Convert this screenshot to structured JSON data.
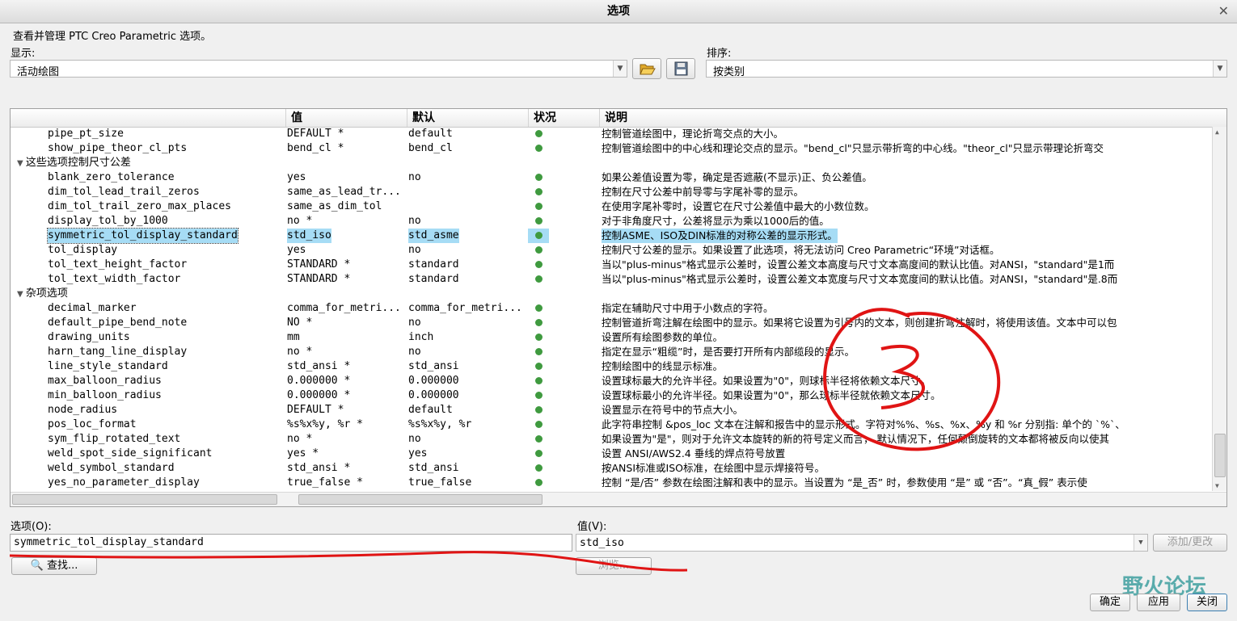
{
  "window": {
    "title": "选项",
    "close": "✕"
  },
  "intro": "查看并管理 PTC Creo Parametric 选项。",
  "show": {
    "label": "显示:",
    "value": "活动绘图"
  },
  "sort": {
    "label": "排序:",
    "value": "按类别"
  },
  "columns": {
    "value": "值",
    "default": "默认",
    "status": "状况",
    "desc": "说明"
  },
  "rows": [
    {
      "name": "pipe_pt_size",
      "value": "DEFAULT *",
      "default": "default",
      "desc": "控制管道绘图中，理论折弯交点的大小。"
    },
    {
      "name": "show_pipe_theor_cl_pts",
      "value": "bend_cl *",
      "default": "bend_cl",
      "desc": "控制管道绘图中的中心线和理论交点的显示。\"bend_cl\"只显示带折弯的中心线。\"theor_cl\"只显示带理论折弯交"
    },
    {
      "group": true,
      "name": "这些选项控制尺寸公差"
    },
    {
      "name": "blank_zero_tolerance",
      "value": "yes",
      "default": "no",
      "desc": "如果公差值设置为零，确定是否遮蔽(不显示)正、负公差值。"
    },
    {
      "name": "dim_tol_lead_trail_zeros",
      "value": "same_as_lead_tr...",
      "default": "",
      "desc": "控制在尺寸公差中前导零与字尾补零的显示。"
    },
    {
      "name": "dim_tol_trail_zero_max_places",
      "value": "same_as_dim_tol",
      "default": "",
      "desc": "在使用字尾补零时，设置它在尺寸公差值中最大的小数位数。"
    },
    {
      "name": "display_tol_by_1000",
      "value": "no *",
      "default": "no",
      "desc": "对于非角度尺寸，公差将显示为乘以1000后的值。"
    },
    {
      "name": "symmetric_tol_display_standard",
      "value": "std_iso",
      "default": "std_asme",
      "desc": "控制ASME、ISO及DIN标准的对称公差的显示形式。",
      "selected": true
    },
    {
      "name": "tol_display",
      "value": "yes",
      "default": "no",
      "desc": "控制尺寸公差的显示。如果设置了此选项，将无法访问 Creo Parametric“环境”对话框。"
    },
    {
      "name": "tol_text_height_factor",
      "value": "STANDARD *",
      "default": "standard",
      "desc": "当以\"plus-minus\"格式显示公差时，设置公差文本高度与尺寸文本高度间的默认比值。对ANSI，\"standard\"是1而"
    },
    {
      "name": "tol_text_width_factor",
      "value": "STANDARD *",
      "default": "standard",
      "desc": "当以\"plus-minus\"格式显示公差时，设置公差文本宽度与尺寸文本宽度间的默认比值。对ANSI，\"standard\"是.8而"
    },
    {
      "group": true,
      "name": "杂项选项"
    },
    {
      "name": "decimal_marker",
      "value": "comma_for_metri...",
      "default": "comma_for_metri...",
      "desc": "指定在辅助尺寸中用于小数点的字符。"
    },
    {
      "name": "default_pipe_bend_note",
      "value": "NO *",
      "default": "no",
      "desc": "控制管道折弯注解在绘图中的显示。如果将它设置为引号内的文本，则创建折弯注解时，将使用该值。文本中可以包"
    },
    {
      "name": "drawing_units",
      "value": "mm",
      "default": "inch",
      "desc": "设置所有绘图参数的单位。"
    },
    {
      "name": "harn_tang_line_display",
      "value": "no *",
      "default": "no",
      "desc": "指定在显示“粗缆”时，是否要打开所有内部缆段的显示。"
    },
    {
      "name": "line_style_standard",
      "value": "std_ansi *",
      "default": "std_ansi",
      "desc": "控制绘图中的线显示标准。"
    },
    {
      "name": "max_balloon_radius",
      "value": "0.000000 *",
      "default": "0.000000",
      "desc": "设置球标最大的允许半径。如果设置为\"0\"，则球标半径将依赖文本尺寸。"
    },
    {
      "name": "min_balloon_radius",
      "value": "0.000000 *",
      "default": "0.000000",
      "desc": "设置球标最小的允许半径。如果设置为\"0\"，那么球标半径就依赖文本尺寸。"
    },
    {
      "name": "node_radius",
      "value": "DEFAULT *",
      "default": "default",
      "desc": "设置显示在符号中的节点大小。"
    },
    {
      "name": "pos_loc_format",
      "value": "%s%x%y, %r *",
      "default": "%s%x%y, %r",
      "desc": "此字符串控制 &pos_loc 文本在注解和报告中的显示形式。字符对%%、%s、%x、%y 和 %r 分别指: 单个的 `%`、"
    },
    {
      "name": "sym_flip_rotated_text",
      "value": "no *",
      "default": "no",
      "desc": "如果设置为\"是\"，则对于允许文本旋转的新的符号定义而言， 默认情况下，任何颠倒旋转的文本都将被反向以使其"
    },
    {
      "name": "weld_spot_side_significant",
      "value": "yes *",
      "default": "yes",
      "desc": "设置 ANSI/AWS2.4 垂线的焊点符号放置"
    },
    {
      "name": "weld_symbol_standard",
      "value": "std_ansi *",
      "default": "std_ansi",
      "desc": "按ANSI标准或ISO标准，在绘图中显示焊接符号。"
    },
    {
      "name": "yes_no_parameter_display",
      "value": "true_false *",
      "default": "true_false",
      "desc": "控制 “是/否” 参数在绘图注解和表中的显示。当设置为 “是_否” 时，参数使用 “是” 或 “否”。“真_假” 表示使"
    }
  ],
  "option_field": {
    "label": "选项(O):",
    "value": "symmetric_tol_display_standard"
  },
  "value_field": {
    "label": "值(V):",
    "value": "std_iso"
  },
  "buttons": {
    "add": "添加/更改",
    "find": "🔍 查找...",
    "browse": "浏览...",
    "ok": "确定",
    "apply": "应用",
    "close": "关闭"
  },
  "watermark": "野火论坛"
}
